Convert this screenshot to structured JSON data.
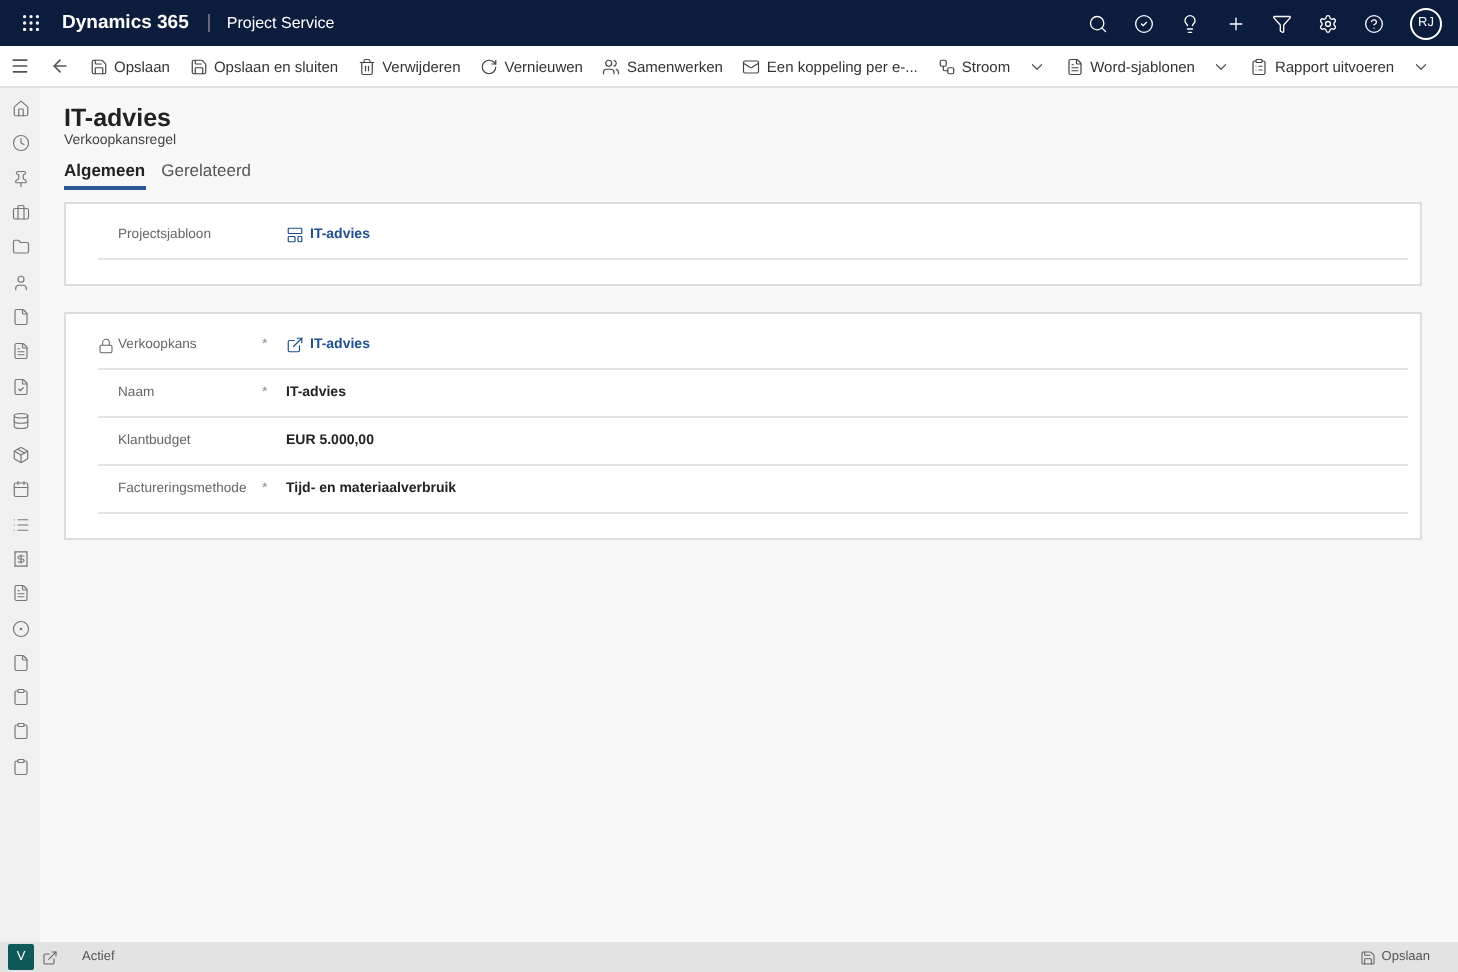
{
  "header": {
    "product": "Dynamics 365",
    "app": "Project Service",
    "user_initials": "RJ"
  },
  "commands": [
    {
      "label": "Opslaan",
      "kind": "save",
      "dropdown": false
    },
    {
      "label": "Opslaan en sluiten",
      "kind": "saveclose",
      "dropdown": false
    },
    {
      "label": "Verwijderen",
      "kind": "delete",
      "dropdown": false
    },
    {
      "label": "Vernieuwen",
      "kind": "refresh",
      "dropdown": false
    },
    {
      "label": "Samenwerken",
      "kind": "collaborate",
      "dropdown": false
    },
    {
      "label": "Een koppeling per e-...",
      "kind": "email",
      "dropdown": false
    },
    {
      "label": "Stroom",
      "kind": "flow",
      "dropdown": true
    },
    {
      "label": "Word-sjablonen",
      "kind": "word",
      "dropdown": true
    },
    {
      "label": "Rapport uitvoeren",
      "kind": "report",
      "dropdown": true
    }
  ],
  "record": {
    "title": "IT-advies",
    "subtitle": "Verkoopkansregel"
  },
  "tabs": [
    {
      "label": "Algemeen",
      "selected": true
    },
    {
      "label": "Gerelateerd",
      "selected": false
    }
  ],
  "sections": [
    {
      "fields": [
        {
          "label": "Projectsjabloon",
          "locked": false,
          "kind": "template",
          "value": "IT-advies"
        }
      ]
    },
    {
      "fields": [
        {
          "label": "Verkoopkans",
          "required_marker": "*",
          "locked": true,
          "kind": "lookup",
          "value": "IT-advies"
        },
        {
          "label": "Naam",
          "required_marker": "*",
          "locked": false,
          "kind": "text",
          "value": "IT-advies"
        },
        {
          "label": "Klantbudget",
          "locked": false,
          "kind": "text",
          "value": "EUR 5.000,00"
        },
        {
          "label": "Factureringsmethode",
          "required_marker": "*",
          "locked": false,
          "kind": "text",
          "value": "Tijd- en materiaalverbruik"
        }
      ]
    }
  ],
  "status_bar": {
    "area_initial": "V",
    "status": "Actief",
    "save": "Opslaan"
  }
}
